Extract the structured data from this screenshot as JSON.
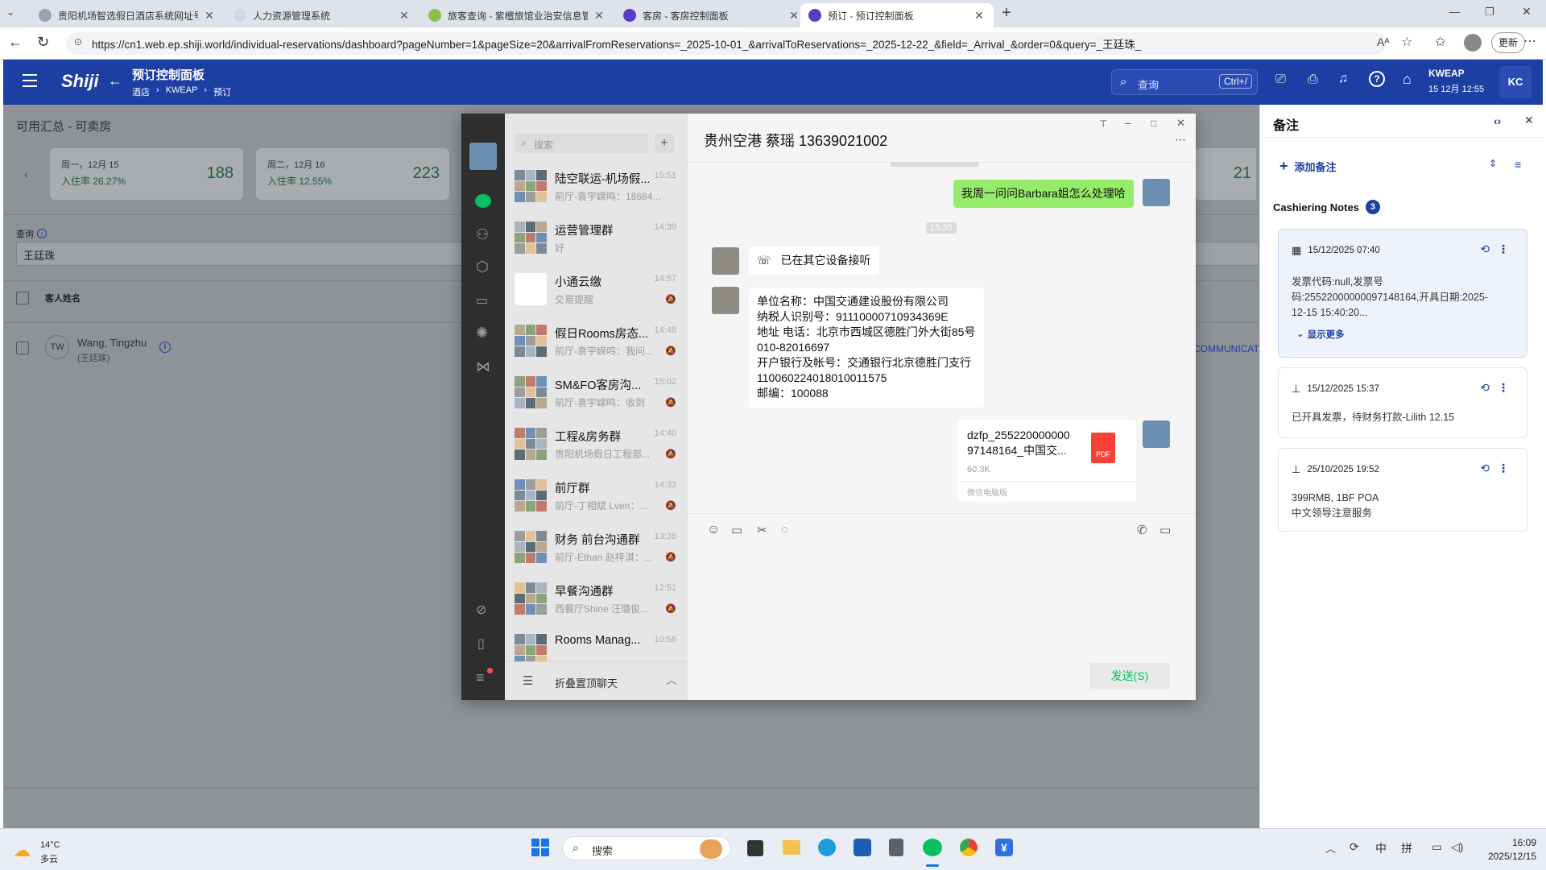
{
  "browser": {
    "tabs": [
      {
        "title": "贵阳机场智选假日酒店系统网址号",
        "color": "#9aa3ad"
      },
      {
        "title": "人力资源管理系统",
        "color": "#cfd8e3"
      },
      {
        "title": "旅客查询 - 紫檀旅馆业治安信息管",
        "color": "#8bc34a"
      },
      {
        "title": "客房 - 客房控制面板",
        "color": "#5b3cc4"
      },
      {
        "title": "预订 - 预订控制面板",
        "color": "#5b3cc4"
      }
    ],
    "url": "https://cn1.web.ep.shiji.world/individual-reservations/dashboard?pageNumber=1&pageSize=20&arrivalFromReservations=_2025-10-01_&arrivalToReservations=_2025-12-22_&field=_Arrival_&order=0&query=_王廷珠_",
    "update_label": "更新"
  },
  "app": {
    "logo": "Shiji",
    "title": "预订控制面板",
    "breadcrumb": [
      "酒店",
      "KWEAP",
      "预订"
    ],
    "search_placeholder": "查询",
    "search_shortcut": "Ctrl+/",
    "property": "KWEAP",
    "datetime": "15 12月 12:55",
    "user_initials": "KC"
  },
  "availability": {
    "title": "可用汇总 - 可卖房",
    "days": [
      {
        "day": "周一，12月 15",
        "occupancy": "入住率 26.27%",
        "count": "188"
      },
      {
        "day": "周二，12月 16",
        "occupancy": "入住率 12.55%",
        "count": "223"
      }
    ],
    "hidden_count": "21"
  },
  "search": {
    "label": "查询",
    "value": "王廷珠"
  },
  "table": {
    "column_guest": "客人姓名",
    "rows": [
      {
        "initials": "TW",
        "name": "Wang, Tingzhu",
        "native": "(王廷珠)",
        "trailing": "COMMUNICAT"
      }
    ]
  },
  "wechat": {
    "search_placeholder": "搜索",
    "chats": [
      {
        "name": "陆空联运-机场假...",
        "time": "15:51",
        "msg": "前厅-袁宇嵘鸣：18684...",
        "muted": false
      },
      {
        "name": "运营管理群",
        "time": "14:39",
        "msg": "好",
        "muted": false
      },
      {
        "name": "小通云缴",
        "time": "14:57",
        "msg": "交易提醒",
        "muted": true
      },
      {
        "name": "假日Rooms房态...",
        "time": "14:48",
        "msg": "前厅-袁宇嵘鸣：我问...",
        "muted": true
      },
      {
        "name": "SM&FO客房沟...",
        "time": "15:02",
        "msg": "前厅-袁宇嵘鸣：收到",
        "muted": true
      },
      {
        "name": "工程&房务群",
        "time": "14:40",
        "msg": "贵阳机场假日工程部...",
        "muted": true
      },
      {
        "name": "前厅群",
        "time": "14:33",
        "msg": "前厅-丁相斌 Lven：...",
        "muted": true
      },
      {
        "name": "财务 前台沟通群",
        "time": "13:36",
        "msg": "前厅-Ethan 赵梓淇：...",
        "muted": true
      },
      {
        "name": "早餐沟通群",
        "time": "12:51",
        "msg": "西餐厅Shine 汪璐俊...",
        "muted": true
      },
      {
        "name": "Rooms Manag...",
        "time": "10:56",
        "msg": "",
        "muted": false
      }
    ],
    "fold_label": "折叠置顶聊天",
    "chat_title": "贵州空港 蔡瑶 13639021002",
    "msg_out_1": "我周一问问Barbara姐怎么处理哈",
    "time_divider": "15:35",
    "call_text": "已在其它设备接听",
    "invoice_lines": [
      "单位名称：中国交通建设股份有限公司",
      "纳税人识别号：91110000710934369E",
      "地址 电话：北京市西城区德胜门外大街85号",
      "010-82016697",
      "开户银行及帐号：交通银行北京德胜门支行",
      "110060224018010011575",
      "邮编：100088"
    ],
    "file": {
      "name_line1": "dzfp_255220000000",
      "name_line2": "97148164_中国交...",
      "size": "60.3K",
      "source": "微信电脑版",
      "badge": "PDF"
    },
    "send_label": "发送(S)"
  },
  "notes_panel": {
    "title": "备注",
    "add_label": "添加备注",
    "section": "Cashiering Notes",
    "count": "3",
    "notes": [
      {
        "datetime": "15/12/2025 07:40",
        "lines": [
          "发票代码:null,发票号",
          "码:25522000000097148164,开具日期:2025-",
          "12-15 15:40:20..."
        ],
        "more": "显示更多"
      },
      {
        "datetime": "15/12/2025 15:37",
        "lines": [
          "已开具发票，待财务打款-Lilith 12.15"
        ]
      },
      {
        "datetime": "25/10/2025 19:52",
        "lines": [
          "399RMB, 1BF POA",
          "中文领导注意服务"
        ]
      }
    ]
  },
  "taskbar": {
    "temp": "14°C",
    "weather": "多云",
    "search": "搜索",
    "ime1": "中",
    "ime2": "拼",
    "time": "16:09",
    "date": "2025/12/15"
  }
}
